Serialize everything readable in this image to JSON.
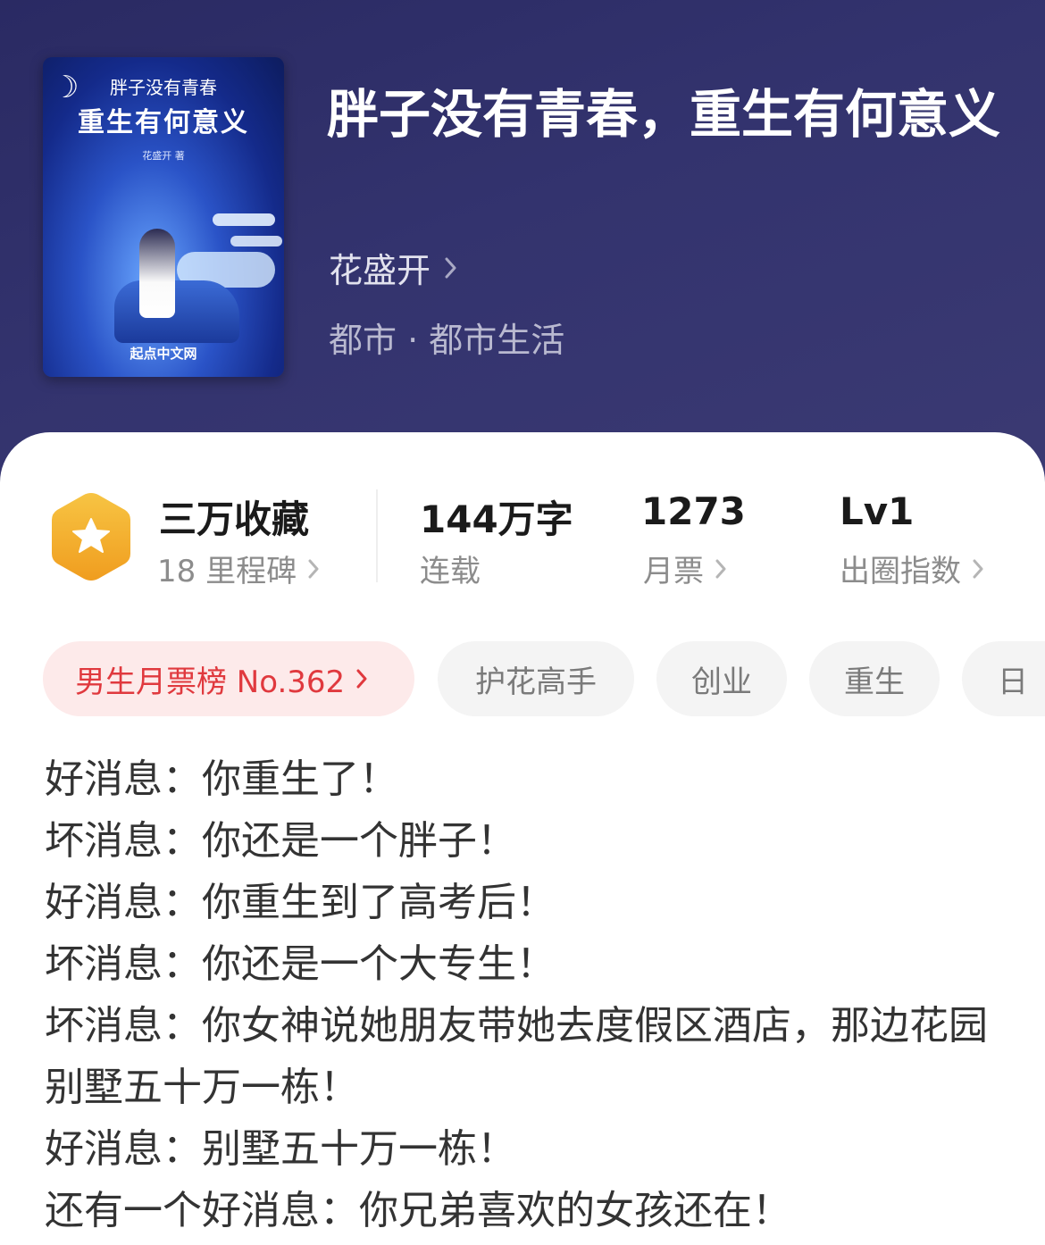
{
  "book": {
    "cover": {
      "title_small": "胖子没有青春",
      "title_big": "重生有何意义",
      "author": "花盛开 著",
      "publisher": "起点中文网"
    },
    "title": "胖子没有青春，重生有何意义",
    "author": "花盛开",
    "genre": "都市 · 都市生活"
  },
  "stats": {
    "collect": {
      "main": "三万收藏",
      "sub": "18 里程碑"
    },
    "words": {
      "main": "144万字",
      "sub": "连载"
    },
    "monthly": {
      "main": "1273",
      "sub": "月票"
    },
    "level": {
      "main": "Lv1",
      "sub": "出圈指数"
    }
  },
  "tags": {
    "rank": "男生月票榜 No.362",
    "items": [
      "护花高手",
      "创业",
      "重生",
      "日"
    ]
  },
  "description": [
    "好消息：你重生了！",
    "坏消息：你还是一个胖子！",
    "好消息：你重生到了高考后！",
    "坏消息：你还是一个大专生！",
    "坏消息：你女神说她朋友带她去度假区酒店，那边花园别墅五十万一栋！",
    "好消息：别墅五十万一栋！",
    "还有一个好消息：你兄弟喜欢的女孩还在！"
  ],
  "colors": {
    "hero_bg": "#2f2f6a",
    "rank_tag_bg": "#fdeaea",
    "rank_tag_text": "#e0393e",
    "badge": "#f5b52e"
  },
  "icons": {
    "badge": "star-hexagon-icon",
    "chevron": "chevron-right-icon"
  }
}
